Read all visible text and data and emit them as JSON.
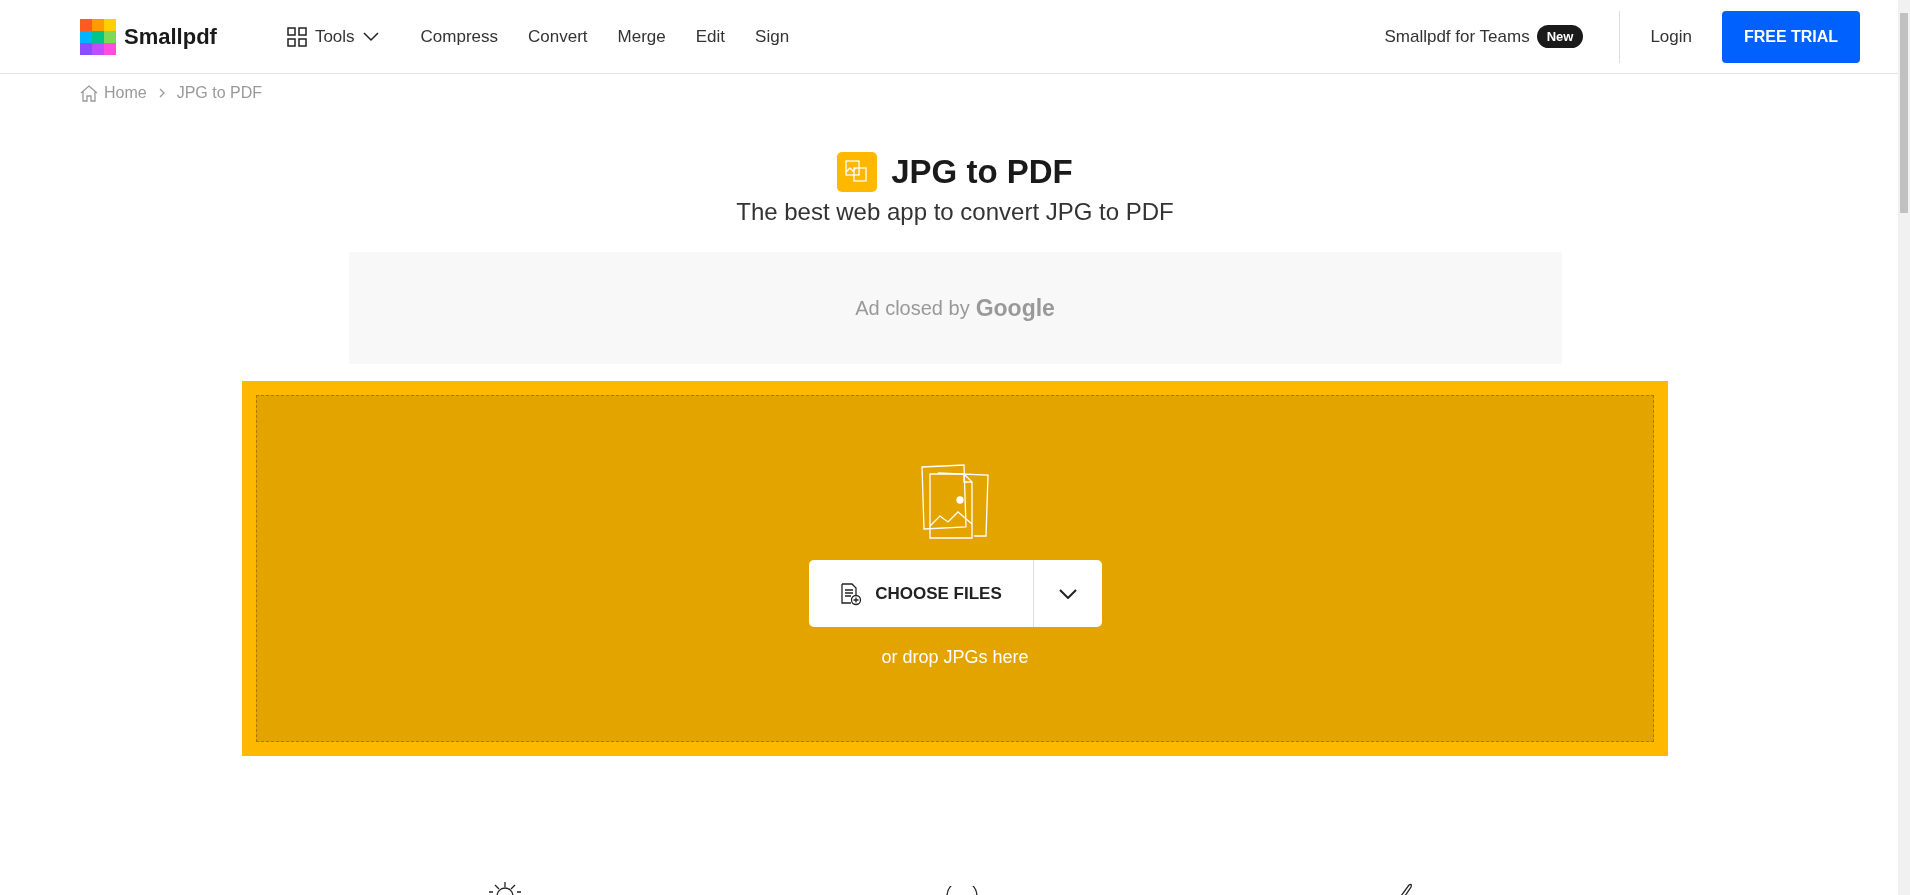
{
  "header": {
    "brand": "Smallpdf",
    "tools_menu": {
      "label": "Tools",
      "expanded": false
    },
    "nav": [
      "Compress",
      "Convert",
      "Merge",
      "Edit",
      "Sign"
    ],
    "teams": {
      "label": "Smallpdf for Teams",
      "badge": "New"
    },
    "login": "Login",
    "trial": "FREE TRIAL"
  },
  "breadcrumb": [
    "Home",
    "JPG to PDF"
  ],
  "title": "JPG to PDF",
  "subtitle": "The best web app to convert JPG to PDF",
  "ad": {
    "text": "Ad closed by",
    "brand": "Google"
  },
  "upload": {
    "button": "CHOOSE FILES",
    "hint": "or drop JPGs here"
  }
}
